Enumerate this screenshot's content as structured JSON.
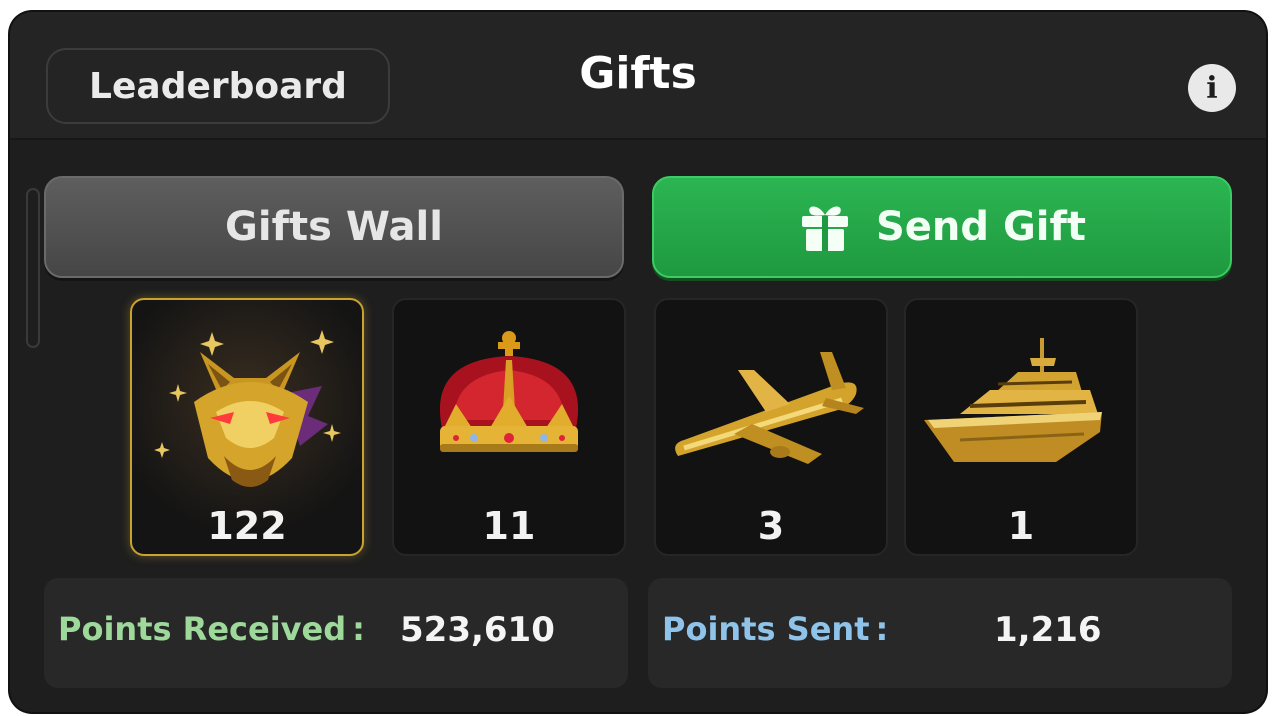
{
  "header": {
    "leaderboard_label": "Leaderboard",
    "title": "Gifts",
    "info_icon": "info-icon"
  },
  "tabs": {
    "gifts_wall_label": "Gifts Wall",
    "send_gift_label": "Send Gift",
    "send_gift_icon": "gift-box-icon"
  },
  "gifts": [
    {
      "name": "golden-wolf",
      "count": "122",
      "selected": true
    },
    {
      "name": "royal-crown",
      "count": "11",
      "selected": false
    },
    {
      "name": "golden-airplane",
      "count": "3",
      "selected": false
    },
    {
      "name": "golden-yacht",
      "count": "1",
      "selected": false
    }
  ],
  "stats": {
    "received_label": "Points Received",
    "received_value": "523,610",
    "sent_label": "Points Sent",
    "sent_value": "1,216",
    "separator": ":"
  },
  "colors": {
    "panel_bg": "#1e1e1e",
    "send_green": "#22a847",
    "received_label": "#9ed99b",
    "sent_label": "#8fc3ea",
    "selected_border": "#c9a230"
  }
}
